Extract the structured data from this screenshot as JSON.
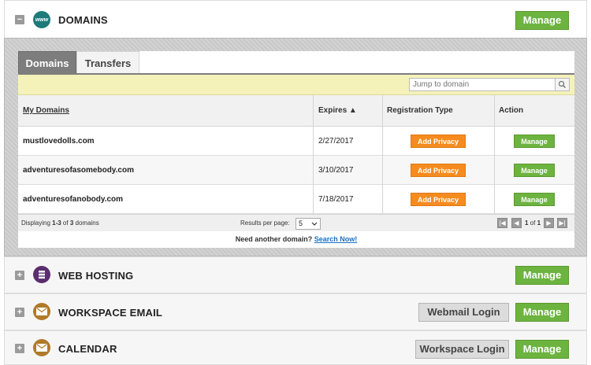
{
  "domains_section": {
    "title": "DOMAINS",
    "icon_label": "www",
    "manage_label": "Manage",
    "tabs": [
      {
        "label": "Domains",
        "active": true
      },
      {
        "label": "Transfers",
        "active": false
      }
    ],
    "search_placeholder": "Jump to domain",
    "columns": [
      "My Domains",
      "Expires ▲",
      "Registration Type",
      "Action"
    ],
    "rows": [
      {
        "domain": "mustlovedolls.com",
        "expires": "2/27/2017",
        "privacy_label": "Add Privacy",
        "action_label": "Manage"
      },
      {
        "domain": "adventuresofasomebody.com",
        "expires": "3/10/2017",
        "privacy_label": "Add Privacy",
        "action_label": "Manage"
      },
      {
        "domain": "adventuresofanobody.com",
        "expires": "7/18/2017",
        "privacy_label": "Add Privacy",
        "action_label": "Manage"
      }
    ],
    "footer": {
      "display_prefix": "Displaying ",
      "display_range": "1-3",
      "display_middle": " of ",
      "display_total": "3",
      "display_suffix": " domains",
      "per_page_label": "Results per page:",
      "per_page_value": "5",
      "page_prefix": "",
      "page_current": "1",
      "page_middle": " of ",
      "page_total": "1"
    },
    "another_text": "Need another domain?",
    "another_link": "Search Now!"
  },
  "web_hosting": {
    "title": "WEB HOSTING",
    "manage_label": "Manage"
  },
  "workspace_email": {
    "title": "WORKSPACE EMAIL",
    "webmail_label": "Webmail Login",
    "manage_label": "Manage"
  },
  "calendar": {
    "title": "CALENDAR",
    "workspace_label": "Workspace Login",
    "manage_label": "Manage"
  },
  "colors": {
    "accent_green": "#6db33f",
    "privacy_orange": "#f68b1f",
    "link_blue": "#1a6fc2",
    "highlight_yellow": "#f5f2b9"
  }
}
